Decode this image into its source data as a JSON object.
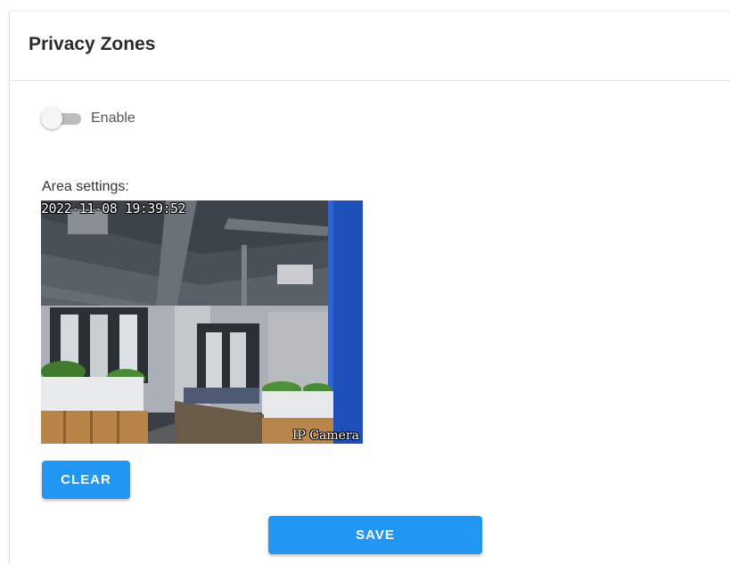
{
  "header": {
    "title": "Privacy Zones"
  },
  "toggle": {
    "label": "Enable",
    "enabled": false
  },
  "area": {
    "label": "Area settings:",
    "preview": {
      "timestamp": "2022-11-08 19:39:52",
      "camera_label": "IP Camera"
    }
  },
  "actions": {
    "clear_label": "CLEAR",
    "save_label": "SAVE"
  },
  "colors": {
    "accent": "#2196f3",
    "switch_track_off": "#bdbdbd",
    "switch_thumb_off": "#f5f5f5"
  }
}
